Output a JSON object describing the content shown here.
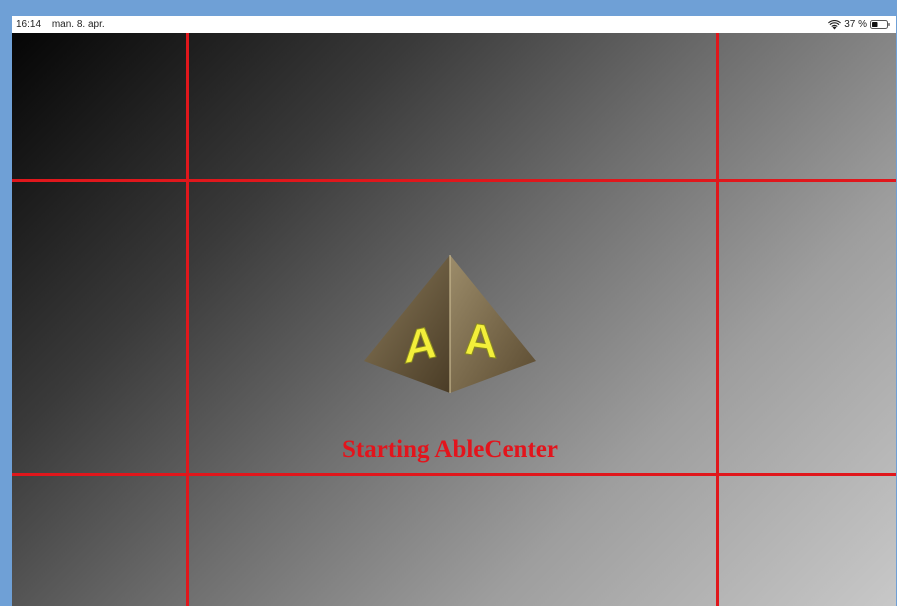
{
  "status_bar": {
    "time": "16:14",
    "date": "man. 8. apr.",
    "battery": "37 %"
  },
  "icons": {
    "wifi": "wifi-icon",
    "battery": "battery-icon",
    "logo": "pyramid-logo-icon"
  },
  "logo": {
    "left_letter": "A",
    "right_letter": "A"
  },
  "main": {
    "loading_text": "Starting AbleCenter"
  },
  "colors": {
    "grid_line": "#e0171c",
    "loading_text": "#e3141c",
    "logo_letters": "#f3ef3a"
  }
}
